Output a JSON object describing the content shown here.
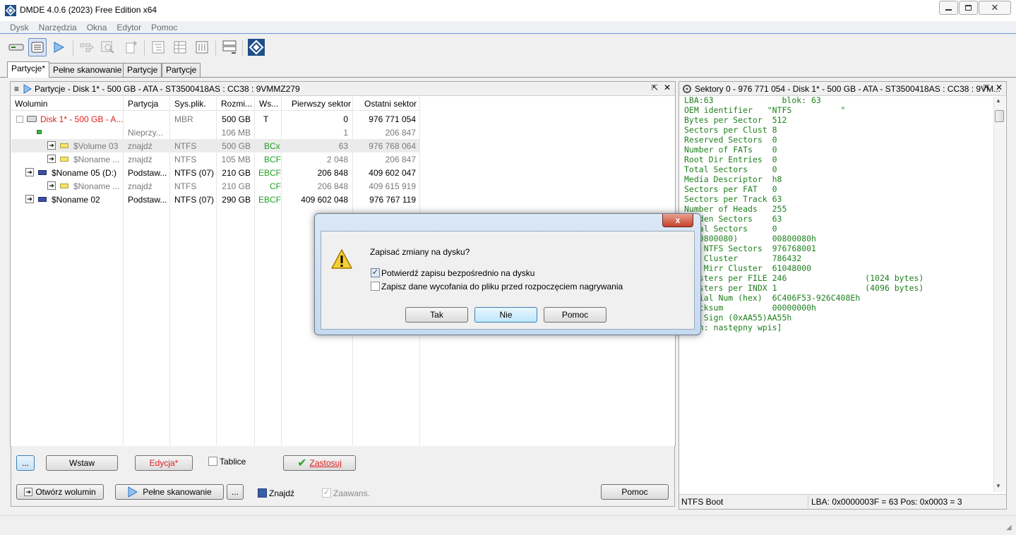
{
  "window": {
    "title": "DMDE 4.0.6 (2023) Free Edition x64"
  },
  "menu": [
    "Dysk",
    "Narzędzia",
    "Okna",
    "Edytor",
    "Pomoc"
  ],
  "tabs": [
    "Partycje*",
    "Pełne skanowanie",
    "Partycje",
    "Partycje"
  ],
  "left_panel": {
    "title": "Partycje - Disk 1* - 500 GB - ATA - ST3500418AS : CC38 : 9VMMZ279",
    "columns": [
      "Wolumin",
      "Partycja",
      "Sys.plik.",
      "Rozmi...",
      "Ws...",
      "Pierwszy sektor",
      "Ostatni sektor"
    ],
    "rows": [
      {
        "name": "Disk 1* - 500 GB - A...",
        "part": "",
        "fs": "MBR",
        "size": "500 GB",
        "flags": "T",
        "first": "0",
        "last": "976 771 054"
      },
      {
        "name": "",
        "part": "Nieprzy...",
        "fs": "",
        "size": "106 MB",
        "flags": "",
        "first": "1",
        "last": "206 847"
      },
      {
        "name": "$Volume 03",
        "part": "znajdź",
        "fs": "NTFS",
        "size": "500 GB",
        "flags": "BCx",
        "first": "63",
        "last": "976 768 064"
      },
      {
        "name": "$Noname ...",
        "part": "znajdź",
        "fs": "NTFS",
        "size": "105 MB",
        "flags": "BCF",
        "first": "2 048",
        "last": "206 847"
      },
      {
        "name": "$Noname 05 (D:)",
        "part": "Podstaw...",
        "fs": "NTFS (07)",
        "size": "210 GB",
        "flags": "EBCF",
        "first": "206 848",
        "last": "409 602 047"
      },
      {
        "name": "$Noname ...",
        "part": "znajdź",
        "fs": "NTFS",
        "size": "210 GB",
        "flags": "CF",
        "first": "206 848",
        "last": "409 615 919"
      },
      {
        "name": "$Noname 02",
        "part": "Podstaw...",
        "fs": "NTFS (07)",
        "size": "290 GB",
        "flags": "EBCF",
        "first": "409 602 048",
        "last": "976 767 119"
      }
    ],
    "buttons": {
      "more": "...",
      "insert": "Wstaw",
      "edit": "Edycja*",
      "tables": "Tablice",
      "apply": "Zastosuj",
      "open_volume": "Otwórz wolumin",
      "full_scan": "Pełne skanowanie",
      "more2": "...",
      "find": "Znajdź",
      "advanced": "Zaawans.",
      "help": "Pomoc"
    }
  },
  "right_panel": {
    "title": "Sektory 0 - 976 771 054 - Disk 1* - 500 GB - ATA - ST3500418AS : CC38 : 9VM...",
    "lines": [
      "LBA:63              blok: 63",
      "OEM identifier   \"NTFS          \"",
      "Bytes per Sector  512",
      "Sectors per Clust 8",
      "Reserved Sectors  0",
      "Number of FATs    0",
      "Root Dir Entries  0",
      "Total Sectors     0",
      "Media Descriptor  h8",
      "Sectors per FAT   0",
      "Sectors per Track 63",
      "Number of Heads   255",
      "   den Sectors    63",
      "   al Sectors     0",
      "  00800080)       00800080h",
      "    NTFS Sectors  976768001",
      "    Cluster       786432",
      "    Mirr Cluster  61048000",
      "   sters per FILE 246                (1024 bytes)",
      "   sters per INDX 1                  (4096 bytes)",
      "   ial Num (hex)  6C406F53-926C408Eh",
      "   cksum          00000000h",
      "    Sign (0xAA55)AA55h",
      "   n: następny wpis]"
    ],
    "status_left": "NTFS Boot",
    "status_right": "LBA: 0x0000003F = 63  Pos: 0x0003 = 3"
  },
  "dialog": {
    "close": "x",
    "question": "Zapisać zmiany na dysku?",
    "option1": "Potwierdź zapisu bezpośrednio na dysku",
    "option2": "Zapisz dane wycofania do pliku przed rozpoczęciem nagrywania",
    "yes": "Tak",
    "no": "Nie",
    "help": "Pomoc"
  }
}
